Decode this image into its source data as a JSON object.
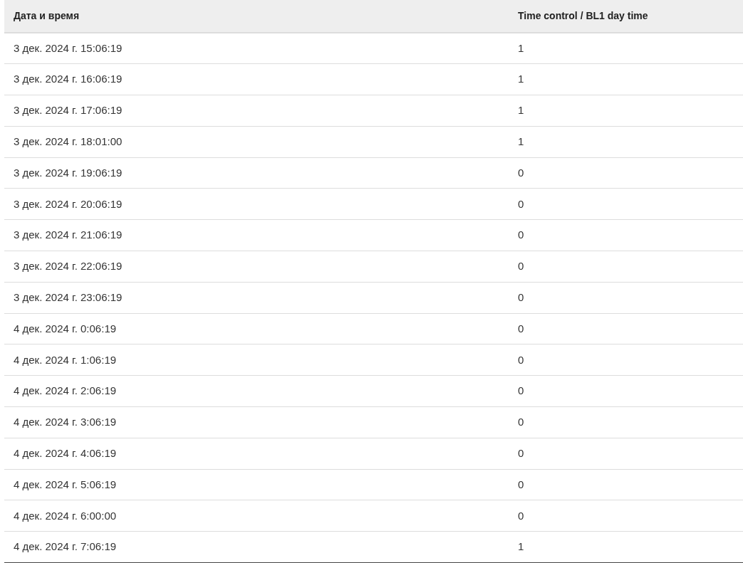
{
  "table": {
    "columns": [
      "Дата и время",
      "Time control / BL1 day time"
    ],
    "rows": [
      [
        "3 дек. 2024 г. 15:06:19",
        "1"
      ],
      [
        "3 дек. 2024 г. 16:06:19",
        "1"
      ],
      [
        "3 дек. 2024 г. 17:06:19",
        "1"
      ],
      [
        "3 дек. 2024 г. 18:01:00",
        "1"
      ],
      [
        "3 дек. 2024 г. 19:06:19",
        "0"
      ],
      [
        "3 дек. 2024 г. 20:06:19",
        "0"
      ],
      [
        "3 дек. 2024 г. 21:06:19",
        "0"
      ],
      [
        "3 дек. 2024 г. 22:06:19",
        "0"
      ],
      [
        "3 дек. 2024 г. 23:06:19",
        "0"
      ],
      [
        "4 дек. 2024 г. 0:06:19",
        "0"
      ],
      [
        "4 дек. 2024 г. 1:06:19",
        "0"
      ],
      [
        "4 дек. 2024 г. 2:06:19",
        "0"
      ],
      [
        "4 дек. 2024 г. 3:06:19",
        "0"
      ],
      [
        "4 дек. 2024 г. 4:06:19",
        "0"
      ],
      [
        "4 дек. 2024 г. 5:06:19",
        "0"
      ],
      [
        "4 дек. 2024 г. 6:00:00",
        "0"
      ],
      [
        "4 дек. 2024 г. 7:06:19",
        "1"
      ]
    ]
  }
}
